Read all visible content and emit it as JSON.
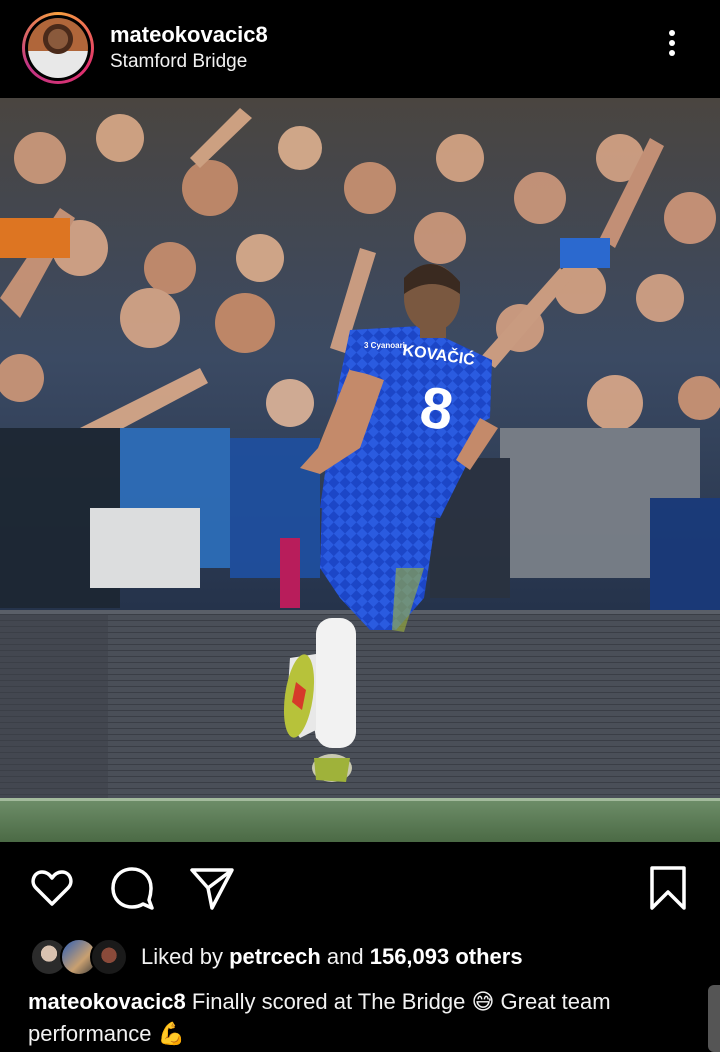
{
  "post": {
    "username": "mateokovacic8",
    "location": "Stamford Bridge"
  },
  "photo": {
    "jersey_name": "KOVAČIĆ",
    "jersey_number": "8",
    "sponsor": "3 Cyanoari"
  },
  "actions": {
    "like_icon": "heart-icon",
    "comment_icon": "comment-icon",
    "share_icon": "send-icon",
    "save_icon": "bookmark-icon"
  },
  "likes": {
    "prefix": "Liked by ",
    "first_liker": "petrcech",
    "middle": " and ",
    "others": "156,093 others"
  },
  "caption": {
    "username": "mateokovacic8",
    "text1": " Finally scored at The Bridge ",
    "emoji1": "😅",
    "text2": " Great team performance ",
    "emoji2": "💪"
  },
  "colors": {
    "background": "#000000",
    "text": "#ffffff",
    "jersey_blue": "#1c46c7"
  }
}
